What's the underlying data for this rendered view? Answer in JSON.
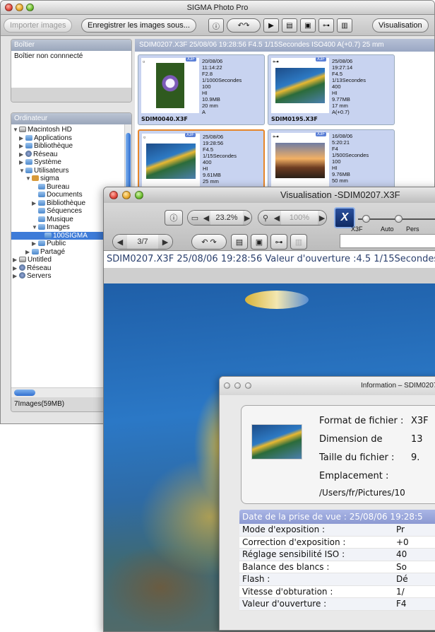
{
  "main_window": {
    "title": "SIGMA Photo Pro",
    "toolbar": {
      "import_label": "Importer images",
      "save_label": "Enregistrer les images sous...",
      "visualisation_label": "Visualisation"
    },
    "boitier": {
      "header": "Boîtier",
      "status": "Boîtier non connnecté"
    },
    "ordinateur": {
      "header": "Ordinateur",
      "tree": [
        {
          "label": "Macintosh HD",
          "icon": "hard-disk-icon",
          "level": 0,
          "expanded": true
        },
        {
          "label": "Applications",
          "icon": "folder-icon",
          "level": 1,
          "expanded": false
        },
        {
          "label": "Bibliothèque",
          "icon": "folder-icon",
          "level": 1,
          "expanded": false
        },
        {
          "label": "Réseau",
          "icon": "network-icon",
          "level": 1,
          "expanded": false
        },
        {
          "label": "Système",
          "icon": "folder-icon",
          "level": 1,
          "expanded": false
        },
        {
          "label": "Utilisateurs",
          "icon": "folder-icon",
          "level": 1,
          "expanded": true
        },
        {
          "label": "sigma",
          "icon": "home-icon",
          "level": 2,
          "expanded": true
        },
        {
          "label": "Bureau",
          "icon": "folder-icon",
          "level": 3
        },
        {
          "label": "Documents",
          "icon": "folder-icon",
          "level": 3
        },
        {
          "label": "Bibliothèque",
          "icon": "folder-icon",
          "level": 3,
          "expanded": false
        },
        {
          "label": "Séquences",
          "icon": "folder-icon",
          "level": 3
        },
        {
          "label": "Musique",
          "icon": "folder-icon",
          "level": 3
        },
        {
          "label": "Images",
          "icon": "folder-icon",
          "level": 3,
          "expanded": true
        },
        {
          "label": "100SIGMA",
          "icon": "folder-icon",
          "level": 4,
          "selected": true
        },
        {
          "label": "Public",
          "icon": "folder-icon",
          "level": 3,
          "expanded": false
        },
        {
          "label": "Partagé",
          "icon": "folder-icon",
          "level": 2,
          "expanded": false
        },
        {
          "label": "Untitled",
          "icon": "hard-disk-icon",
          "level": 0,
          "expanded": false
        },
        {
          "label": "Réseau",
          "icon": "network-icon",
          "level": 0,
          "expanded": false
        },
        {
          "label": "Servers",
          "icon": "network-icon",
          "level": 0,
          "expanded": false
        }
      ]
    },
    "status_bar": "7Images(59MB)",
    "info_strip": "SDIM0207.X3F  25/08/06 19:28:56 F4.5 1/15Secondes ISO400 A(+0.7) 25 mm",
    "thumbnails": [
      {
        "filename": "SDIM0040.X3F",
        "meta": "20/08/06\n11:14:22\nF2.8\n1/1000Secondes\n100\nHI\n10.9MB\n20 mm\nA",
        "badge": "X3F",
        "photo": "passion-flower",
        "selected": false,
        "locked": false
      },
      {
        "filename": "SDIM0195.X3F",
        "meta": "25/08/06\n19:27:14\nF4.5\n1/13Secondes\n400\nHI\n9.77MB\n17 mm\nA(+0.7)",
        "badge": "X3F",
        "photo": "fish",
        "selected": false,
        "locked": true
      },
      {
        "filename": "",
        "meta": "25/08/06\n19:28:56\nF4.5\n1/15Secondes\n400\nHI\n9.61MB\n25 mm",
        "badge": "X3F",
        "photo": "fish",
        "selected": true,
        "locked": false
      },
      {
        "filename": "",
        "meta": "16/08/06\n5:20:21\nF4\n1/500Secondes\n100\nHI\n9.76MB\n50 mm",
        "badge": "X3F",
        "photo": "sunset",
        "selected": false,
        "locked": true
      }
    ]
  },
  "viz_window": {
    "title": "Visualisation -SDIM0207.X3F",
    "zoom_fit": "23.2%",
    "zoom_actual": "100%",
    "page_counter": "3/7",
    "badge": "X3F",
    "modes": [
      "X3F",
      "Auto",
      "Pers"
    ],
    "caption": "SDIM0207.X3F 25/08/06 19:28:56 Valeur d'ouverture :4.5 1/15Secondes"
  },
  "info_window": {
    "title": "Information – SDIM0207.X3F",
    "fields": [
      {
        "label": "Format de fichier :",
        "value": "X3F"
      },
      {
        "label": "Dimension de",
        "value": "13"
      },
      {
        "label": "Taille du fichier :",
        "value": "9."
      },
      {
        "label": "Emplacement :",
        "value": ""
      }
    ],
    "path": "/Users/fr/Pictures/10",
    "date_header": "Date de la prise de vue : 25/08/06 19:28:5",
    "rows": [
      {
        "k": "Mode d'exposition :",
        "v": "Pr"
      },
      {
        "k": "Correction d'exposition :",
        "v": "+0"
      },
      {
        "k": "Réglage sensibilité ISO :",
        "v": "40"
      },
      {
        "k": "Balance des blancs :",
        "v": "So"
      },
      {
        "k": "Flash :",
        "v": "Dé"
      },
      {
        "k": "Vitesse d'obturation :",
        "v": "1/"
      },
      {
        "k": "Valeur d'ouverture :",
        "v": "F4"
      }
    ]
  }
}
